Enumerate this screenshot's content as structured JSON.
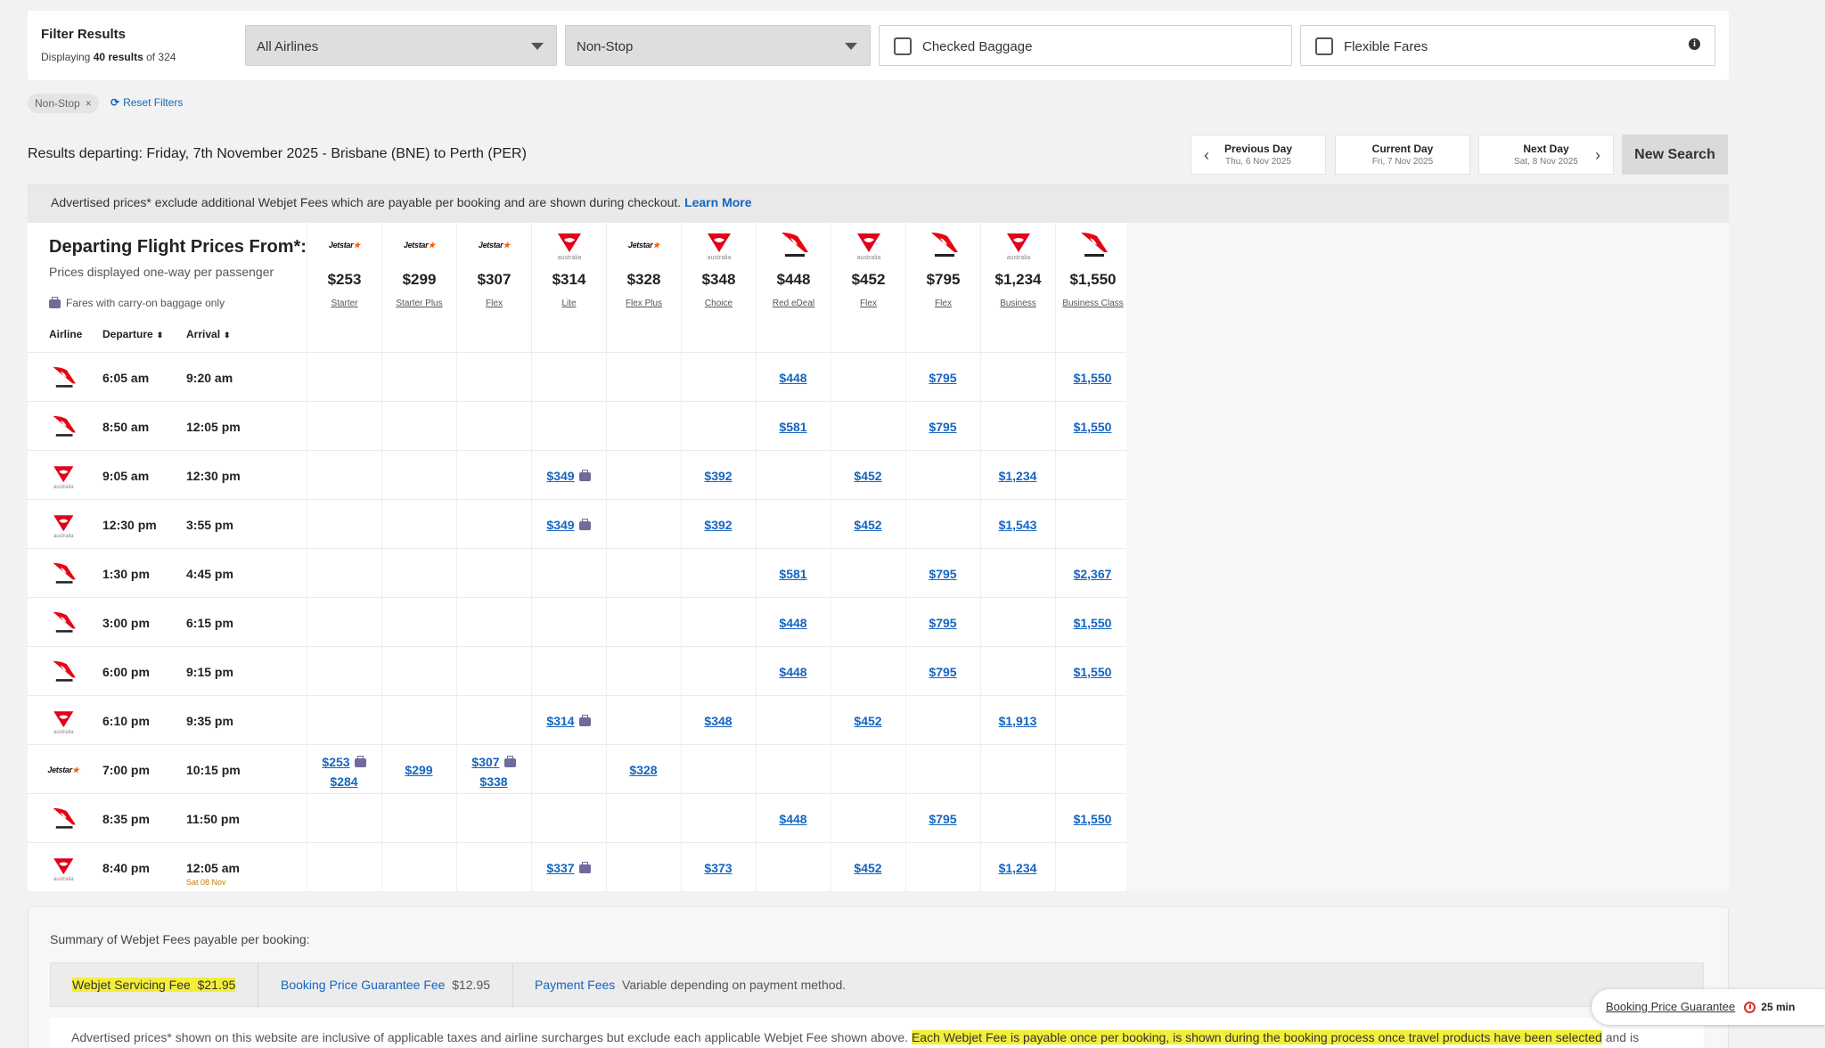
{
  "filters": {
    "title": "Filter Results",
    "count_prefix": "Displaying",
    "count_shown": "40 results",
    "count_suffix": "of 324",
    "airlines_select": "All Airlines",
    "stops_select": "Non-Stop",
    "checked_baggage": "Checked Baggage",
    "flexible_fares": "Flexible Fares",
    "info_icon": "info-icon",
    "active_chip": "Non-Stop",
    "chip_remove": "×",
    "reset": "Reset Filters"
  },
  "results_header": {
    "title": "Results departing: Friday, 7th November 2025 - Brisbane (BNE) to Perth (PER)",
    "prev_day": {
      "label": "Previous Day",
      "date": "Thu, 6 Nov 2025"
    },
    "current_day": {
      "label": "Current Day",
      "date": "Fri, 7 Nov 2025"
    },
    "next_day": {
      "label": "Next Day",
      "date": "Sat, 8 Nov 2025"
    },
    "new_search": "New Search"
  },
  "notice": {
    "text": "Advertised prices* exclude additional Webjet Fees which are payable per booking and are shown during checkout.",
    "link": "Learn More"
  },
  "price_grid": {
    "title": "Departing Flight Prices From*:",
    "subtitle": "Prices displayed one-way per passenger",
    "carry_on_note": "Fares with carry-on baggage only",
    "col_airline": "Airline",
    "col_departure": "Departure",
    "col_arrival": "Arrival",
    "sort_icon": "⬍",
    "fares": [
      {
        "airline": "jetstar",
        "price": "$253",
        "type": "Starter"
      },
      {
        "airline": "jetstar",
        "price": "$299",
        "type": "Starter Plus"
      },
      {
        "airline": "jetstar",
        "price": "$307",
        "type": "Flex"
      },
      {
        "airline": "virgin",
        "price": "$314",
        "type": "Lite"
      },
      {
        "airline": "jetstar",
        "price": "$328",
        "type": "Flex Plus"
      },
      {
        "airline": "virgin",
        "price": "$348",
        "type": "Choice"
      },
      {
        "airline": "qantas",
        "price": "$448",
        "type": "Red eDeal"
      },
      {
        "airline": "virgin",
        "price": "$452",
        "type": "Flex"
      },
      {
        "airline": "qantas",
        "price": "$795",
        "type": "Flex"
      },
      {
        "airline": "virgin",
        "price": "$1,234",
        "type": "Business"
      },
      {
        "airline": "qantas",
        "price": "$1,550",
        "type": "Business Class"
      }
    ],
    "flights": [
      {
        "airline": "qantas",
        "dep": "6:05 am",
        "arr": "9:20 am",
        "next_day": "",
        "cells": [
          {
            "col": 6,
            "v": [
              "$448"
            ]
          },
          {
            "col": 8,
            "v": [
              "$795"
            ]
          },
          {
            "col": 10,
            "v": [
              "$1,550"
            ]
          }
        ]
      },
      {
        "airline": "qantas",
        "dep": "8:50 am",
        "arr": "12:05 pm",
        "next_day": "",
        "cells": [
          {
            "col": 6,
            "v": [
              "$581"
            ]
          },
          {
            "col": 8,
            "v": [
              "$795"
            ]
          },
          {
            "col": 10,
            "v": [
              "$1,550"
            ]
          }
        ]
      },
      {
        "airline": "virgin",
        "dep": "9:05 am",
        "arr": "12:30 pm",
        "next_day": "",
        "cells": [
          {
            "col": 3,
            "v": [
              "$349"
            ],
            "bag": true
          },
          {
            "col": 5,
            "v": [
              "$392"
            ]
          },
          {
            "col": 7,
            "v": [
              "$452"
            ]
          },
          {
            "col": 9,
            "v": [
              "$1,234"
            ]
          }
        ]
      },
      {
        "airline": "virgin",
        "dep": "12:30 pm",
        "arr": "3:55 pm",
        "next_day": "",
        "cells": [
          {
            "col": 3,
            "v": [
              "$349"
            ],
            "bag": true
          },
          {
            "col": 5,
            "v": [
              "$392"
            ]
          },
          {
            "col": 7,
            "v": [
              "$452"
            ]
          },
          {
            "col": 9,
            "v": [
              "$1,543"
            ]
          }
        ]
      },
      {
        "airline": "qantas",
        "dep": "1:30 pm",
        "arr": "4:45 pm",
        "next_day": "",
        "cells": [
          {
            "col": 6,
            "v": [
              "$581"
            ]
          },
          {
            "col": 8,
            "v": [
              "$795"
            ]
          },
          {
            "col": 10,
            "v": [
              "$2,367"
            ]
          }
        ]
      },
      {
        "airline": "qantas",
        "dep": "3:00 pm",
        "arr": "6:15 pm",
        "next_day": "",
        "cells": [
          {
            "col": 6,
            "v": [
              "$448"
            ]
          },
          {
            "col": 8,
            "v": [
              "$795"
            ]
          },
          {
            "col": 10,
            "v": [
              "$1,550"
            ]
          }
        ]
      },
      {
        "airline": "qantas",
        "dep": "6:00 pm",
        "arr": "9:15 pm",
        "next_day": "",
        "cells": [
          {
            "col": 6,
            "v": [
              "$448"
            ]
          },
          {
            "col": 8,
            "v": [
              "$795"
            ]
          },
          {
            "col": 10,
            "v": [
              "$1,550"
            ]
          }
        ]
      },
      {
        "airline": "virgin",
        "dep": "6:10 pm",
        "arr": "9:35 pm",
        "next_day": "",
        "cells": [
          {
            "col": 3,
            "v": [
              "$314"
            ],
            "bag": true
          },
          {
            "col": 5,
            "v": [
              "$348"
            ]
          },
          {
            "col": 7,
            "v": [
              "$452"
            ]
          },
          {
            "col": 9,
            "v": [
              "$1,913"
            ]
          }
        ]
      },
      {
        "airline": "jetstar",
        "dep": "7:00 pm",
        "arr": "10:15 pm",
        "next_day": "",
        "cells": [
          {
            "col": 0,
            "v": [
              "$253",
              "$284"
            ],
            "bag": true
          },
          {
            "col": 1,
            "v": [
              "$299"
            ]
          },
          {
            "col": 2,
            "v": [
              "$307",
              "$338"
            ],
            "bag": true
          },
          {
            "col": 4,
            "v": [
              "$328"
            ]
          }
        ]
      },
      {
        "airline": "qantas",
        "dep": "8:35 pm",
        "arr": "11:50 pm",
        "next_day": "",
        "cells": [
          {
            "col": 6,
            "v": [
              "$448"
            ]
          },
          {
            "col": 8,
            "v": [
              "$795"
            ]
          },
          {
            "col": 10,
            "v": [
              "$1,550"
            ]
          }
        ]
      },
      {
        "airline": "virgin",
        "dep": "8:40 pm",
        "arr": "12:05 am",
        "next_day": "Sat 08 Nov",
        "cells": [
          {
            "col": 3,
            "v": [
              "$337"
            ],
            "bag": true
          },
          {
            "col": 5,
            "v": [
              "$373"
            ]
          },
          {
            "col": 7,
            "v": [
              "$452"
            ]
          },
          {
            "col": 9,
            "v": [
              "$1,234"
            ]
          }
        ]
      }
    ]
  },
  "summary": {
    "title": "Summary of Webjet Fees payable per booking:",
    "servicing_fee": {
      "label": "Webjet Servicing Fee",
      "value": "$21.95"
    },
    "guarantee_fee": {
      "label": "Booking Price Guarantee Fee",
      "value": "$12.95"
    },
    "payment_fees": {
      "label": "Payment Fees",
      "value": "Variable depending on payment method."
    },
    "text_plain": "Advertised prices* shown on this website are inclusive of applicable taxes and airline surcharges but exclude each applicable Webjet Fee shown above.",
    "text_highlight": "Each Webjet Fee is payable once per booking, is shown during the booking process once travel products have been selected",
    "text_tail": "and is"
  },
  "booking_guarantee": {
    "label": "Booking Price Guarantee",
    "time": "25 min"
  },
  "colors": {
    "accent_link": "#1565c0",
    "qantas_red": "#e30613",
    "virgin_red": "#e1001a",
    "jetstar_orange": "#ff5a00",
    "highlight": "#f3ee3a"
  }
}
